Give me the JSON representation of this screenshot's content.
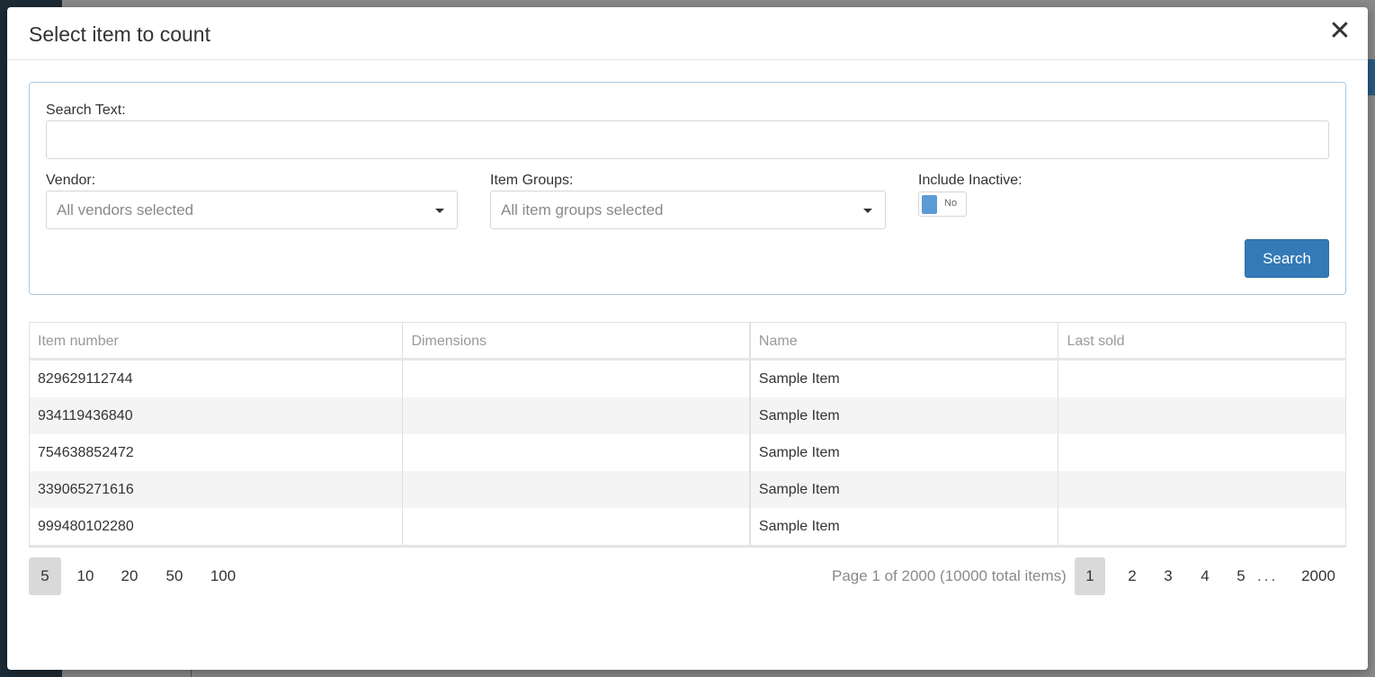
{
  "modal": {
    "title": "Select item to count",
    "close_glyph": "✕"
  },
  "search": {
    "search_text_label": "Search Text:",
    "search_text_value": "",
    "vendor_label": "Vendor:",
    "vendor_value": "All vendors selected",
    "item_groups_label": "Item Groups:",
    "item_groups_value": "All item groups selected",
    "include_inactive_label": "Include Inactive:",
    "include_inactive_state": "No",
    "search_button_label": "Search",
    "accent_color": "#337ab7",
    "toggle_color": "#5b9bd5"
  },
  "table": {
    "columns": [
      "Item number",
      "Dimensions",
      "Name",
      "Last sold"
    ],
    "rows": [
      [
        "829629112744",
        "",
        "Sample Item",
        ""
      ],
      [
        "934119436840",
        "",
        "Sample Item",
        ""
      ],
      [
        "754638852472",
        "",
        "Sample Item",
        ""
      ],
      [
        "339065271616",
        "",
        "Sample Item",
        ""
      ],
      [
        "999480102280",
        "",
        "Sample Item",
        ""
      ]
    ]
  },
  "pager": {
    "page_sizes": [
      "5",
      "10",
      "20",
      "50",
      "100"
    ],
    "active_page_size": "5",
    "info": "Page 1 of 2000 (10000 total items)",
    "pages": [
      "1",
      "2",
      "3",
      "4",
      "5"
    ],
    "ellipsis": "...",
    "last_page": "2000",
    "active_page": "1"
  }
}
